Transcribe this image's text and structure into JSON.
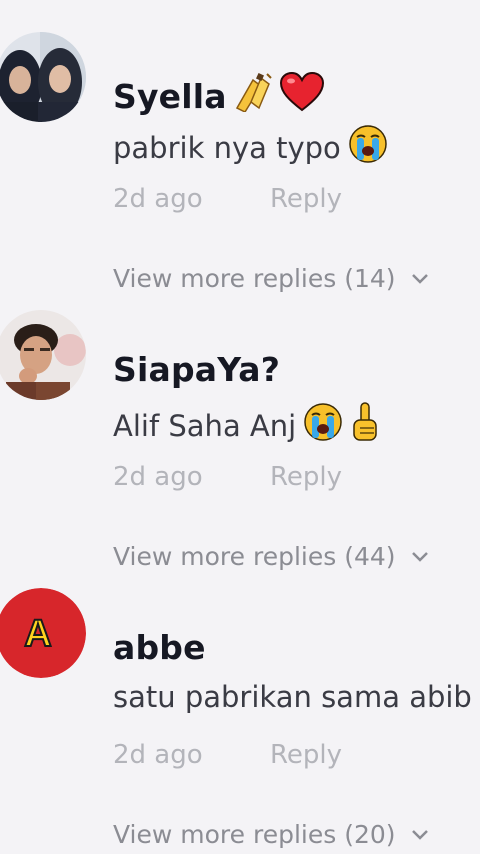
{
  "comments": [
    {
      "username": "Syella",
      "username_emojis": [
        "champagne-toast-emoji",
        "red-heart-emoji"
      ],
      "text": "pabrik nya typo",
      "text_emojis": [
        "loudly-crying-face-emoji"
      ],
      "time": "2d ago",
      "reply_label": "Reply",
      "view_more": "View more replies (14)"
    },
    {
      "username": "SiapaYa?",
      "username_emojis": [],
      "text": "Alif Saha Anj",
      "text_emojis": [
        "loudly-crying-face-emoji",
        "pointing-up-emoji"
      ],
      "time": "2d ago",
      "reply_label": "Reply",
      "view_more": "View more replies (44)"
    },
    {
      "username": "abbe",
      "username_emojis": [],
      "text": "satu pabrikan sama abib",
      "text_emojis": [],
      "avatar_letter": "A",
      "time": "2d ago",
      "reply_label": "Reply",
      "view_more": "View more replies (20)"
    }
  ],
  "colors": {
    "background": "#f4f3f6",
    "username": "#161823",
    "text": "#3a3b44",
    "meta": "#b3b4ba",
    "view_more": "#8b8c93",
    "avatar_red": "#d7262b",
    "avatar_letter_yellow": "#ffd21f"
  }
}
